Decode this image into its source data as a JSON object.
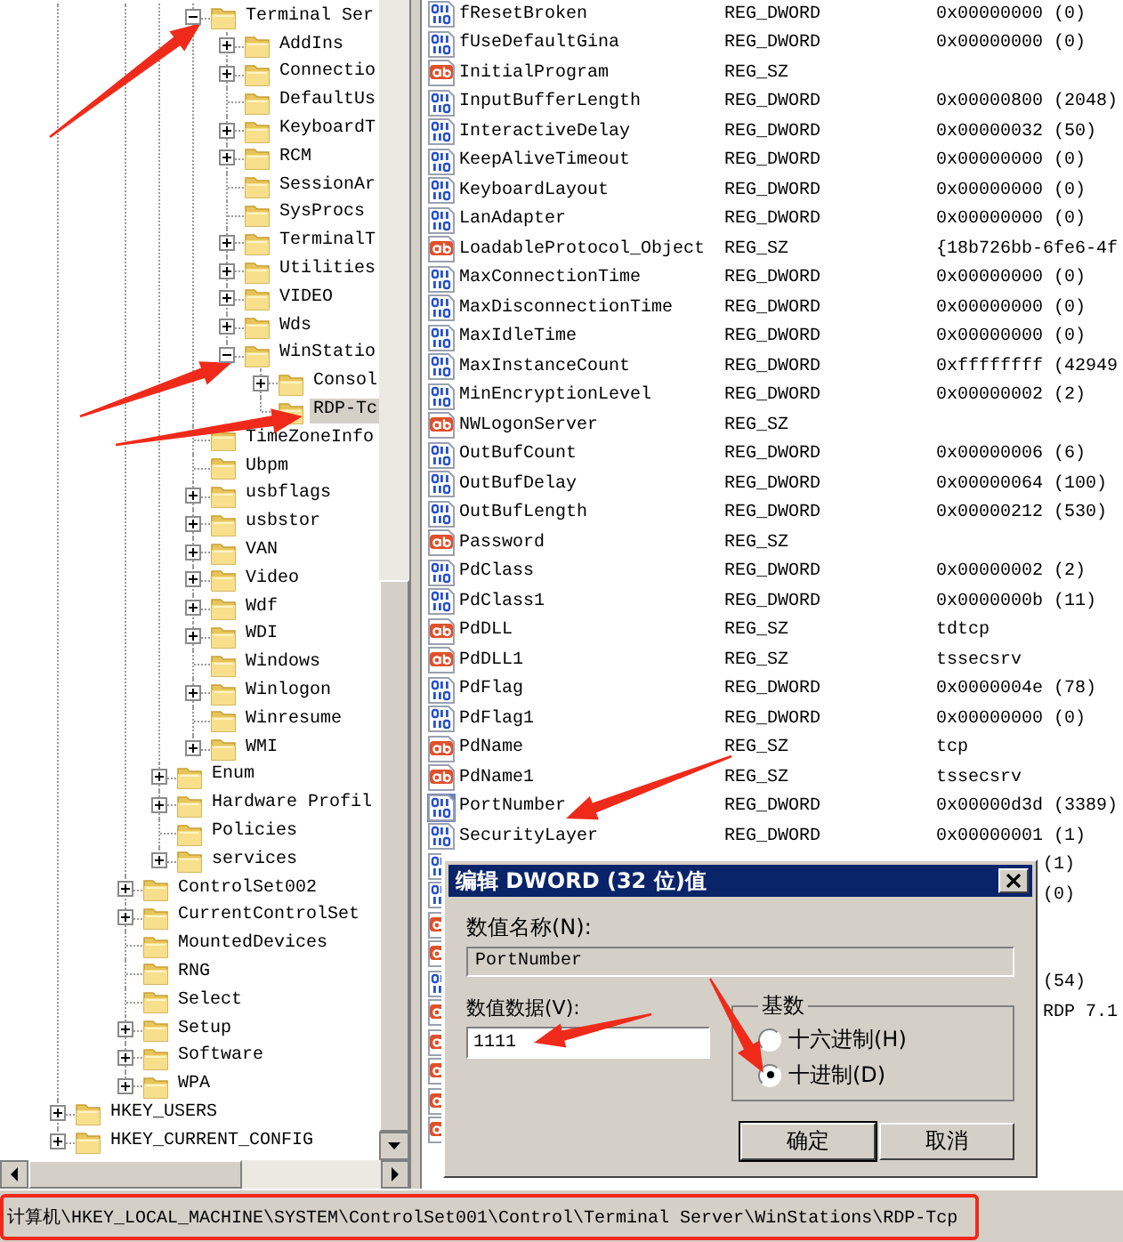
{
  "tree": {
    "items": [
      {
        "children": [
          {
            "children": [
              {
                "children": [
                  {
                    "children": [
                      {
                        "label": "Terminal Ser",
                        "has_children": true,
                        "expanded": true,
                        "selected": false,
                        "children": [
                          {
                            "label": "AddIns",
                            "has_children": true,
                            "expanded": false,
                            "selected": false
                          },
                          {
                            "label": "Connectio",
                            "has_children": true,
                            "expanded": false,
                            "selected": false
                          },
                          {
                            "label": "DefaultUs",
                            "has_children": false,
                            "selected": false
                          },
                          {
                            "label": "KeyboardT",
                            "has_children": true,
                            "expanded": false,
                            "selected": false
                          },
                          {
                            "label": "RCM",
                            "has_children": true,
                            "expanded": false,
                            "selected": false
                          },
                          {
                            "label": "SessionAr",
                            "has_children": false,
                            "selected": false
                          },
                          {
                            "label": "SysProcs",
                            "has_children": false,
                            "selected": false
                          },
                          {
                            "label": "TerminalT",
                            "has_children": true,
                            "expanded": false,
                            "selected": false
                          },
                          {
                            "label": "Utilities",
                            "has_children": true,
                            "expanded": false,
                            "selected": false
                          },
                          {
                            "label": "VIDEO",
                            "has_children": true,
                            "expanded": false,
                            "selected": false
                          },
                          {
                            "label": "Wds",
                            "has_children": true,
                            "expanded": false,
                            "selected": false
                          },
                          {
                            "label": "WinStatio",
                            "has_children": true,
                            "expanded": true,
                            "selected": false,
                            "children": [
                              {
                                "label": "Consol",
                                "has_children": true,
                                "expanded": false,
                                "selected": false
                              },
                              {
                                "label": "RDP-Tc",
                                "has_children": false,
                                "selected": true
                              }
                            ]
                          }
                        ]
                      },
                      {
                        "label": "TimeZoneInfo",
                        "has_children": false,
                        "selected": false
                      },
                      {
                        "label": "Ubpm",
                        "has_children": false,
                        "selected": false
                      },
                      {
                        "label": "usbflags",
                        "has_children": true,
                        "expanded": false,
                        "selected": false
                      },
                      {
                        "label": "usbstor",
                        "has_children": true,
                        "expanded": false,
                        "selected": false
                      },
                      {
                        "label": "VAN",
                        "has_children": true,
                        "expanded": false,
                        "selected": false
                      },
                      {
                        "label": "Video",
                        "has_children": true,
                        "expanded": false,
                        "selected": false
                      },
                      {
                        "label": "Wdf",
                        "has_children": true,
                        "expanded": false,
                        "selected": false
                      },
                      {
                        "label": "WDI",
                        "has_children": true,
                        "expanded": false,
                        "selected": false
                      },
                      {
                        "label": "Windows",
                        "has_children": false,
                        "selected": false
                      },
                      {
                        "label": "Winlogon",
                        "has_children": true,
                        "expanded": false,
                        "selected": false
                      },
                      {
                        "label": "Winresume",
                        "has_children": false,
                        "selected": false
                      },
                      {
                        "label": "WMI",
                        "has_children": true,
                        "expanded": false,
                        "selected": false
                      }
                    ]
                  },
                  {
                    "label": "Enum",
                    "has_children": true,
                    "expanded": false,
                    "selected": false
                  },
                  {
                    "label": "Hardware Profil",
                    "has_children": true,
                    "expanded": false,
                    "selected": false
                  },
                  {
                    "label": "Policies",
                    "has_children": false,
                    "selected": false
                  },
                  {
                    "label": "services",
                    "has_children": true,
                    "expanded": false,
                    "selected": false
                  }
                ]
              },
              {
                "label": "ControlSet002",
                "has_children": true,
                "expanded": false,
                "selected": false
              },
              {
                "label": "CurrentControlSet",
                "has_children": true,
                "expanded": false,
                "selected": false
              },
              {
                "label": "MountedDevices",
                "has_children": false,
                "selected": false
              },
              {
                "label": "RNG",
                "has_children": false,
                "selected": false
              },
              {
                "label": "Select",
                "has_children": false,
                "selected": false
              },
              {
                "label": "Setup",
                "has_children": true,
                "expanded": false,
                "selected": false
              },
              {
                "label": "Software",
                "has_children": true,
                "expanded": false,
                "selected": false
              },
              {
                "label": "WPA",
                "has_children": true,
                "expanded": false,
                "selected": false
              }
            ]
          }
        ]
      },
      {
        "label": "HKEY_USERS",
        "has_children": true,
        "expanded": false,
        "selected": false
      },
      {
        "label": "HKEY_CURRENT_CONFIG",
        "has_children": true,
        "expanded": false,
        "selected": false
      }
    ]
  },
  "values": {
    "rows": [
      {
        "kind": "binary",
        "name": "fResetBroken",
        "type": "REG_DWORD",
        "data": "0x00000000 (0)",
        "selected": false
      },
      {
        "kind": "binary",
        "name": "fUseDefaultGina",
        "type": "REG_DWORD",
        "data": "0x00000000 (0)",
        "selected": false
      },
      {
        "kind": "string",
        "name": "InitialProgram",
        "type": "REG_SZ",
        "selected": false
      },
      {
        "kind": "binary",
        "name": "InputBufferLength",
        "type": "REG_DWORD",
        "data": "0x00000800 (2048)",
        "selected": false
      },
      {
        "kind": "binary",
        "name": "InteractiveDelay",
        "type": "REG_DWORD",
        "data": "0x00000032 (50)",
        "selected": false
      },
      {
        "kind": "binary",
        "name": "KeepAliveTimeout",
        "type": "REG_DWORD",
        "data": "0x00000000 (0)",
        "selected": false
      },
      {
        "kind": "binary",
        "name": "KeyboardLayout",
        "type": "REG_DWORD",
        "data": "0x00000000 (0)",
        "selected": false
      },
      {
        "kind": "binary",
        "name": "LanAdapter",
        "type": "REG_DWORD",
        "data": "0x00000000 (0)",
        "selected": false
      },
      {
        "kind": "string",
        "name": "LoadableProtocol_Object",
        "type": "REG_SZ",
        "data": "{18b726bb-6fe6-4f",
        "selected": false
      },
      {
        "kind": "binary",
        "name": "MaxConnectionTime",
        "type": "REG_DWORD",
        "data": "0x00000000 (0)",
        "selected": false
      },
      {
        "kind": "binary",
        "name": "MaxDisconnectionTime",
        "type": "REG_DWORD",
        "data": "0x00000000 (0)",
        "selected": false
      },
      {
        "kind": "binary",
        "name": "MaxIdleTime",
        "type": "REG_DWORD",
        "data": "0x00000000 (0)",
        "selected": false
      },
      {
        "kind": "binary",
        "name": "MaxInstanceCount",
        "type": "REG_DWORD",
        "data": "0xffffffff (42949",
        "selected": false
      },
      {
        "kind": "binary",
        "name": "MinEncryptionLevel",
        "type": "REG_DWORD",
        "data": "0x00000002 (2)",
        "selected": false
      },
      {
        "kind": "string",
        "name": "NWLogonServer",
        "type": "REG_SZ",
        "selected": false
      },
      {
        "kind": "binary",
        "name": "OutBufCount",
        "type": "REG_DWORD",
        "data": "0x00000006 (6)",
        "selected": false
      },
      {
        "kind": "binary",
        "name": "OutBufDelay",
        "type": "REG_DWORD",
        "data": "0x00000064 (100)",
        "selected": false
      },
      {
        "kind": "binary",
        "name": "OutBufLength",
        "type": "REG_DWORD",
        "data": "0x00000212 (530)",
        "selected": false
      },
      {
        "kind": "string",
        "name": "Password",
        "type": "REG_SZ",
        "selected": false
      },
      {
        "kind": "binary",
        "name": "PdClass",
        "type": "REG_DWORD",
        "data": "0x00000002 (2)",
        "selected": false
      },
      {
        "kind": "binary",
        "name": "PdClass1",
        "type": "REG_DWORD",
        "data": "0x0000000b (11)",
        "selected": false
      },
      {
        "kind": "string",
        "name": "PdDLL",
        "type": "REG_SZ",
        "data": "tdtcp",
        "selected": false
      },
      {
        "kind": "string",
        "name": "PdDLL1",
        "type": "REG_SZ",
        "data": "tssecsrv",
        "selected": false
      },
      {
        "kind": "binary",
        "name": "PdFlag",
        "type": "REG_DWORD",
        "data": "0x0000004e (78)",
        "selected": false
      },
      {
        "kind": "binary",
        "name": "PdFlag1",
        "type": "REG_DWORD",
        "data": "0x00000000 (0)",
        "selected": false
      },
      {
        "kind": "string",
        "name": "PdName",
        "type": "REG_SZ",
        "data": "tcp",
        "selected": false
      },
      {
        "kind": "string",
        "name": "PdName1",
        "type": "REG_SZ",
        "data": "tssecsrv",
        "selected": false
      },
      {
        "kind": "binary",
        "name": "PortNumber",
        "type": "REG_DWORD",
        "data": "0x00000d3d (3389)",
        "selected": true
      },
      {
        "kind": "binary",
        "name": "SecurityLayer",
        "type": "REG_DWORD",
        "data": "0x00000001 (1)",
        "selected": false
      },
      {
        "kind": "binary",
        "data": "(1)",
        "selected": false
      },
      {
        "kind": "binary",
        "data": "(0)",
        "selected": false
      },
      {
        "kind": "string",
        "selected": false
      },
      {
        "kind": "string",
        "selected": false
      },
      {
        "kind": "binary",
        "data": "(54)",
        "selected": false
      },
      {
        "kind": "string",
        "data": "RDP 7.1",
        "selected": false
      },
      {
        "kind": "string",
        "selected": false
      },
      {
        "kind": "string",
        "selected": false
      },
      {
        "kind": "string",
        "selected": false
      },
      {
        "kind": "string",
        "selected": false
      }
    ]
  },
  "dialog": {
    "title": "编辑 DWORD (32 位)值",
    "name_label": "数值名称(N):",
    "name_value": "PortNumber",
    "data_label": "数值数据(V):",
    "data_value": "1111",
    "base_label": "基数",
    "base_options": [
      {
        "label": "十六进制(H)",
        "selected": false
      },
      {
        "label": "十进制(D)",
        "selected": true
      }
    ],
    "buttons": [
      "确定",
      "取消"
    ]
  },
  "status_bar": {
    "path": "计算机\\HKEY_LOCAL_MACHINE\\SYSTEM\\ControlSet001\\Control\\Terminal Server\\WinStations\\RDP-Tcp"
  }
}
